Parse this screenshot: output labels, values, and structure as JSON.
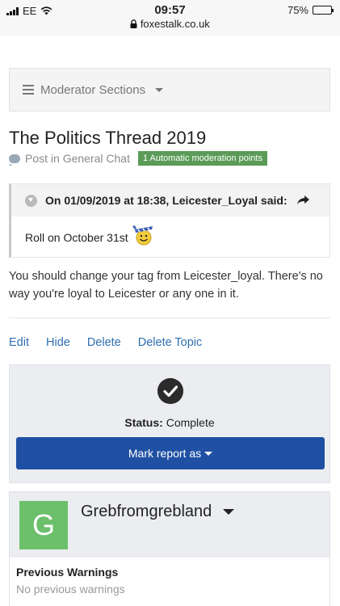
{
  "statusbar": {
    "carrier": "EE",
    "time": "09:57",
    "url": "foxestalk.co.uk",
    "battery": "75%",
    "battery_level": 0.75
  },
  "moderator": {
    "label": "Moderator Sections"
  },
  "topic": {
    "title": "The Politics Thread 2019",
    "post_in": "Post in General Chat",
    "badge": "1 Automatic moderation points"
  },
  "quote": {
    "header": "On 01/09/2019 at 18:38, Leicester_Loyal said:",
    "body": "Roll on October 31st"
  },
  "post": {
    "body": "You should change your tag from Leicester_loyal. There's no way you're loyal to Leicester or any one in it."
  },
  "actions": {
    "edit": "Edit",
    "hide": "Hide",
    "delete": "Delete",
    "delete_topic": "Delete Topic"
  },
  "report": {
    "status_label": "Status:",
    "status_value": "Complete",
    "mark_button": "Mark report as"
  },
  "user": {
    "initial": "G",
    "name": "Grebfromgrebland",
    "avatar_color": "#6cc06b",
    "warnings_title": "Previous Warnings",
    "warnings_text": "No previous warnings"
  },
  "colors": {
    "link": "#2f6fb0",
    "primary_button": "#2050a4",
    "badge": "#5b9b58"
  }
}
